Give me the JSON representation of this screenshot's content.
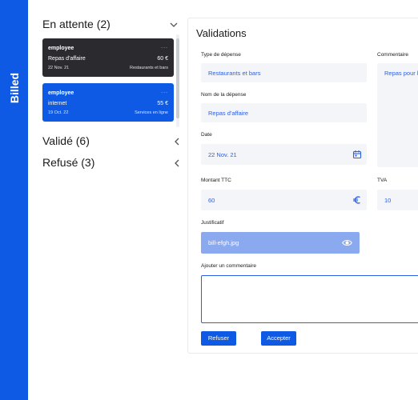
{
  "app": {
    "brand": "Billed"
  },
  "sidebar": {
    "sections": [
      {
        "title": "En attente (2)"
      },
      {
        "title": "Validé (6)"
      },
      {
        "title": "Refusé (3)"
      }
    ],
    "bills": [
      {
        "employee": "employee",
        "name": "Repas d'affaire",
        "amount": "60 €",
        "date": "22 Nov. 21",
        "category": "Restaurants et bars",
        "menu": "..."
      },
      {
        "employee": "employee",
        "name": "internet",
        "amount": "55 €",
        "date": "19 Oct. 22",
        "category": "Services en ligne",
        "menu": "..."
      }
    ]
  },
  "panel": {
    "title": "Validations",
    "labels": {
      "type": "Type de dépense",
      "name": "Nom de la dépense",
      "date": "Date",
      "amount": "Montant TTC",
      "vat": "TVA",
      "comment": "Commentaire",
      "file": "Justificatif",
      "add_comment": "Ajouter un commentaire"
    },
    "values": {
      "type": "Restaurants et bars",
      "name": "Repas d'affaire",
      "date": "22 Nov. 21",
      "amount": "60",
      "vat": "10",
      "comment": "Repas pour la",
      "file": "bill-efgh.jpg"
    },
    "buttons": {
      "refuse": "Refuser",
      "accept": "Accepter"
    }
  },
  "colors": {
    "brand": "#0e5ae5",
    "card_dark": "#2b2b2f",
    "field_bg": "#f4f5f8",
    "value_text": "#2a5fe8"
  },
  "icons": [
    "chevron-down-icon",
    "chevron-left-icon",
    "calendar-icon",
    "euro-icon",
    "eye-icon"
  ]
}
